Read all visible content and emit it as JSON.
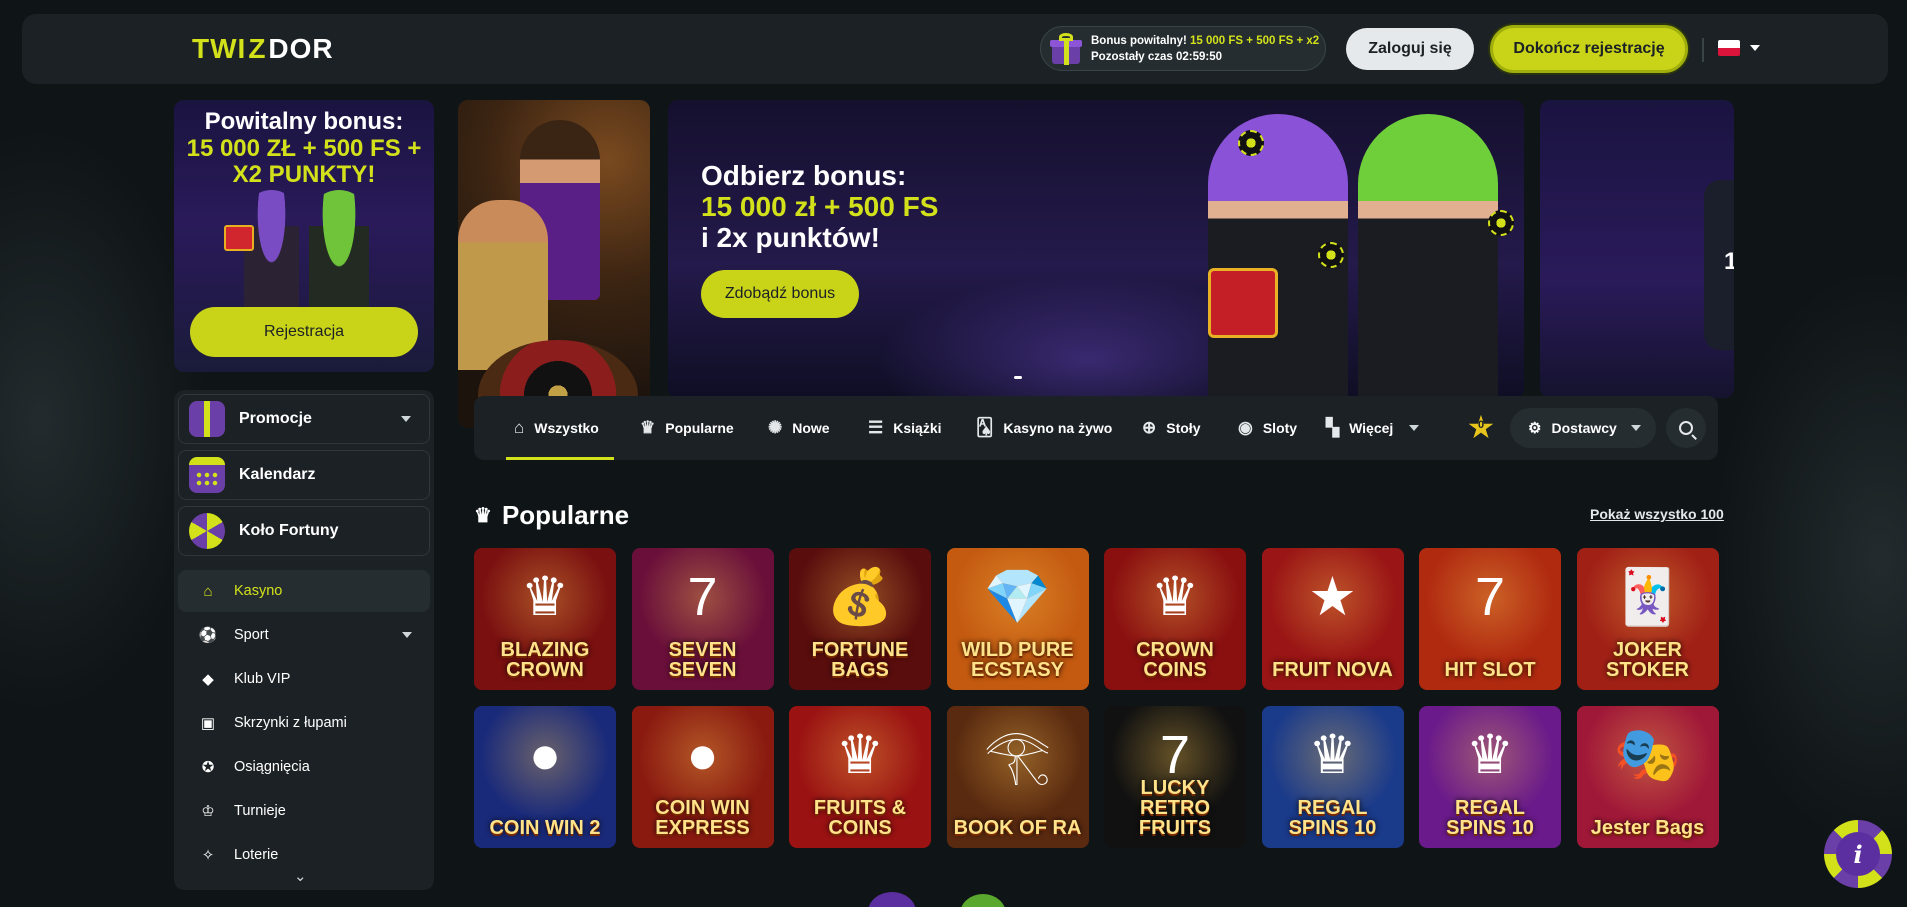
{
  "brand": {
    "logo_part1": "TWI",
    "logo_mid": "Z",
    "logo_part2": "DOR"
  },
  "header": {
    "bonus_line1_prefix": "Bonus powitalny! ",
    "bonus_line1_highlight": "15 000 FS + 500 FS + x2",
    "bonus_line2": "Pozostały czas 02:59:50",
    "login_label": "Zaloguj się",
    "register_label": "Dokończ rejestrację",
    "language": "pl"
  },
  "promo_card": {
    "title": "Powitalny bonus:",
    "highlight": "15 000 ZŁ + 500 FS + X2 PUNKTY!",
    "button": "Rejestracja"
  },
  "sidebar": {
    "featured": [
      {
        "label": "Promocje",
        "icon": "gift-box-icon",
        "has_dropdown": true
      },
      {
        "label": "Kalendarz",
        "icon": "calendar-icon",
        "has_dropdown": false
      },
      {
        "label": "Koło Fortuny",
        "icon": "fortune-wheel-icon",
        "has_dropdown": false
      }
    ],
    "nav": [
      {
        "label": "Kasyno",
        "icon": "home-icon",
        "active": true
      },
      {
        "label": "Sport",
        "icon": "sport-icon",
        "has_dropdown": true
      },
      {
        "label": "Klub VIP",
        "icon": "diamond-icon"
      },
      {
        "label": "Skrzynki z łupami",
        "icon": "loot-box-icon"
      },
      {
        "label": "Osiągnięcia",
        "icon": "achievement-icon"
      },
      {
        "label": "Turnieje",
        "icon": "trophy-icon"
      },
      {
        "label": "Loterie",
        "icon": "lottery-icon"
      }
    ],
    "more_icon": "double-chevron-down-icon"
  },
  "banner": {
    "title_line1": "Odbierz bonus:",
    "title_line2": "15 000 zł + 500 FS",
    "title_line3": "i 2x punktów!",
    "button": "Zdobądź bonus",
    "next_slide_number": "1"
  },
  "categories": [
    {
      "label": "Wszystko",
      "icon": "home-icon",
      "active": true
    },
    {
      "label": "Popularne",
      "icon": "crown-icon"
    },
    {
      "label": "Nowe",
      "icon": "new-badge-icon"
    },
    {
      "label": "Książki",
      "icon": "books-icon"
    },
    {
      "label": "Kasyno na żywo",
      "icon": "live-cards-icon"
    },
    {
      "label": "Stoły",
      "icon": "chip-icon"
    },
    {
      "label": "Sloty",
      "icon": "slots-icon"
    },
    {
      "label": "Więcej",
      "icon": "more-icon"
    }
  ],
  "favorites_count": "0",
  "providers_label": "Dostawcy",
  "popular": {
    "title": "Popularne",
    "show_all": "Pokaż wszystko 100",
    "games": [
      {
        "name": "BLAZING CROWN",
        "bg": "#7a1010",
        "deco": "♛"
      },
      {
        "name": "SEVEN SEVEN",
        "bg": "#6a0f3a",
        "deco": "7"
      },
      {
        "name": "FORTUNE BAGS",
        "bg": "#5a0d0d",
        "deco": "💰"
      },
      {
        "name": "WILD PURE ECSTASY",
        "bg": "#c45a10",
        "deco": "💎"
      },
      {
        "name": "CROWN COINS",
        "bg": "#8a1010",
        "deco": "♛"
      },
      {
        "name": "FRUIT NOVA",
        "bg": "#9a1515",
        "deco": "★"
      },
      {
        "name": "HIT SLOT",
        "bg": "#b02a10",
        "deco": "7"
      },
      {
        "name": "JOKER STOKER",
        "bg": "#a02016",
        "deco": "🃏"
      },
      {
        "name": "COIN WIN 2",
        "bg": "#1a2a7a",
        "deco": "●"
      },
      {
        "name": "COIN WIN EXPRESS",
        "bg": "#8a1a10",
        "deco": "●"
      },
      {
        "name": "FRUITS & COINS",
        "bg": "#9a1212",
        "deco": "♛"
      },
      {
        "name": "BOOK OF RA",
        "bg": "#5a2a10",
        "deco": "𓂀"
      },
      {
        "name": "LUCKY RETRO FRUITS",
        "bg": "#111111",
        "deco": "7"
      },
      {
        "name": "REGAL SPINS 10",
        "bg": "#1a3a8a",
        "deco": "♛"
      },
      {
        "name": "REGAL SPINS 10",
        "bg": "#6a1a8a",
        "deco": "♛"
      },
      {
        "name": "Jester Bags",
        "bg": "#a01838",
        "deco": "🎭"
      }
    ]
  },
  "info_button": "i"
}
